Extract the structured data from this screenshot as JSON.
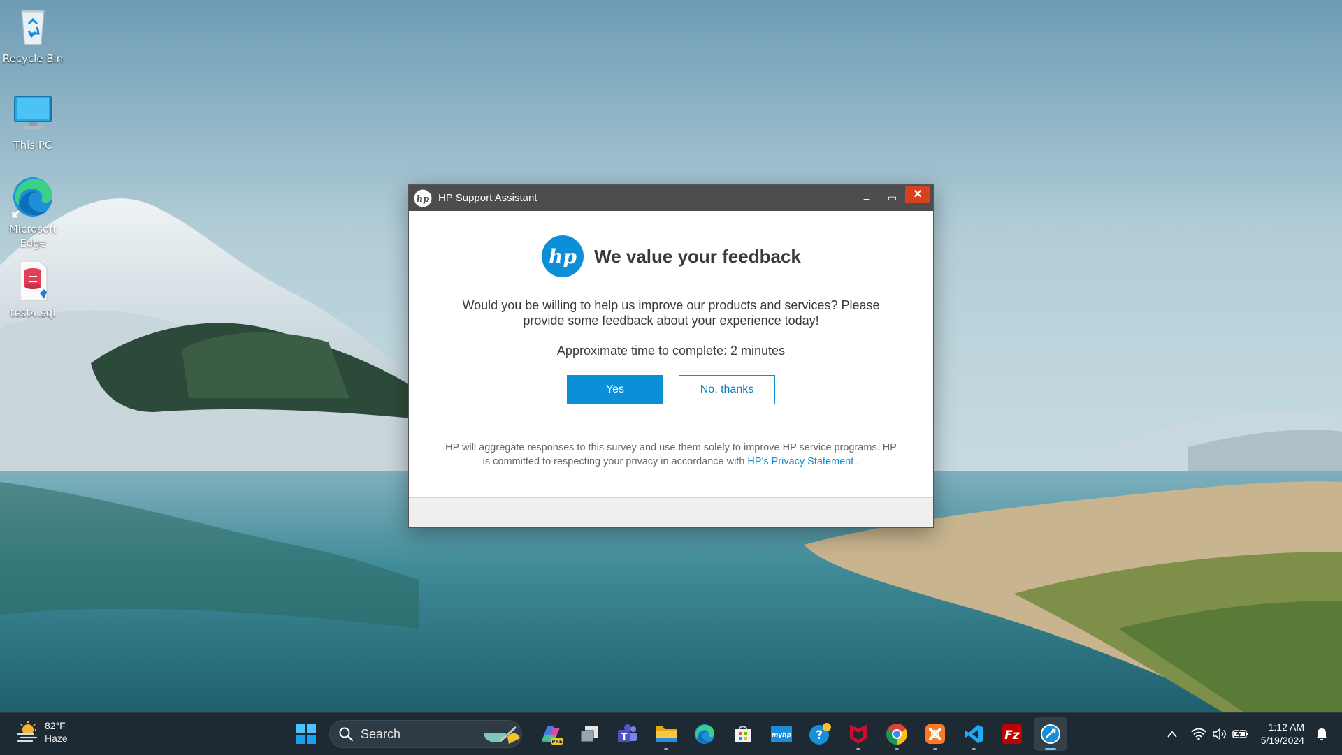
{
  "desktop": {
    "icons": [
      {
        "label": "Recycle Bin",
        "icon": "recycle-bin-icon"
      },
      {
        "label": "This PC",
        "icon": "monitor-icon"
      },
      {
        "label": "Microsoft Edge",
        "icon": "edge-icon"
      },
      {
        "label": "test4.sql",
        "icon": "sql-file-icon"
      }
    ]
  },
  "dialog": {
    "window_title": "HP Support Assistant",
    "minimize_symbol": "–",
    "maximize_symbol": "▭",
    "close_symbol": "✕",
    "heading": "We value your feedback",
    "intro": "Would you be willing to help us improve our products and services? Please provide some feedback about your experience today!",
    "approx_time": "Approximate time to complete: 2 minutes",
    "yes_label": "Yes",
    "no_label": "No, thanks",
    "disclaimer_text": "HP will aggregate responses to this survey and use them solely to improve HP service programs. HP is committed to respecting your privacy in accordance with ",
    "privacy_link": "HP's Privacy Statement",
    "disclaimer_end": " ."
  },
  "taskbar": {
    "weather": {
      "temp": "82°F",
      "condition": "Haze",
      "icon": "weather-haze-icon"
    },
    "search_placeholder": "Search",
    "apps": [
      {
        "name": "start",
        "icon": "windows-start-icon"
      },
      {
        "name": "copilot-preview",
        "icon": "copilot-icon"
      },
      {
        "name": "task-view",
        "icon": "task-view-icon"
      },
      {
        "name": "teams",
        "icon": "teams-icon"
      },
      {
        "name": "file-explorer",
        "icon": "folder-icon"
      },
      {
        "name": "edge",
        "icon": "edge-icon"
      },
      {
        "name": "store",
        "icon": "store-icon"
      },
      {
        "name": "myhp",
        "icon": "myhp-icon"
      },
      {
        "name": "get-help",
        "icon": "help-icon"
      },
      {
        "name": "mcafee",
        "icon": "mcafee-icon"
      },
      {
        "name": "chrome",
        "icon": "chrome-icon"
      },
      {
        "name": "xampp",
        "icon": "xampp-icon"
      },
      {
        "name": "vscode",
        "icon": "vscode-icon"
      },
      {
        "name": "filezilla",
        "icon": "filezilla-icon"
      },
      {
        "name": "hp-support-assistant",
        "icon": "hp-support-icon"
      }
    ],
    "myhp_text": "myhp",
    "copilot_badge": "PRE",
    "tray": {
      "chevron": "^",
      "time": "1:12 AM",
      "date": "5/19/2024"
    }
  },
  "colors": {
    "titlebar": "#4d4d4d",
    "close": "#d9401e",
    "accent": "#0d8fd8",
    "taskbar": "#1e2a33"
  }
}
